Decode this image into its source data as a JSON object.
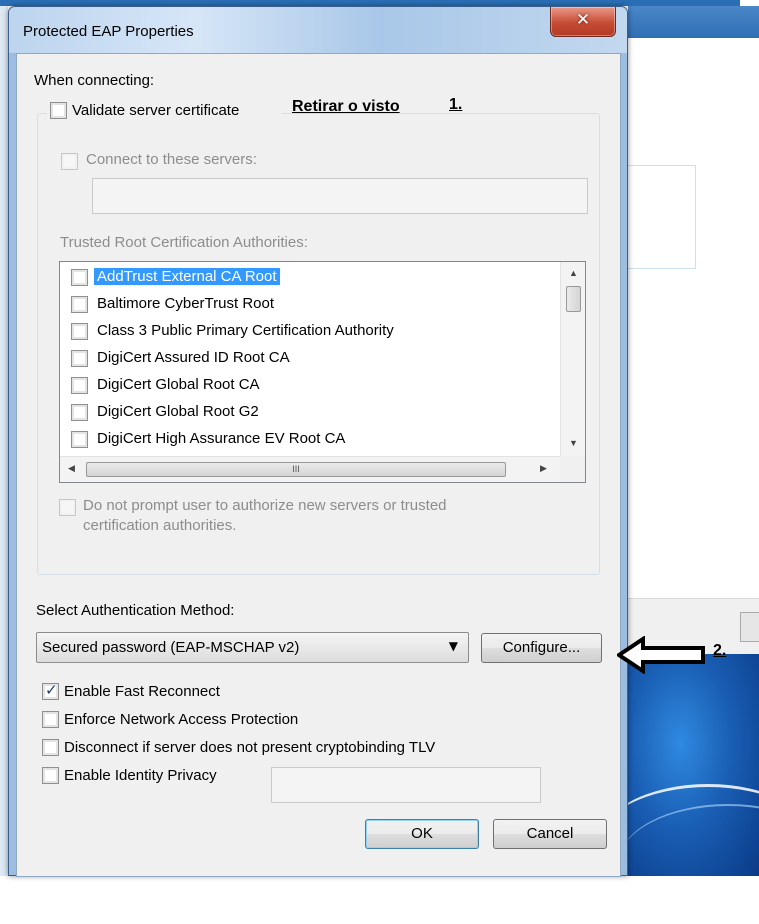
{
  "dialog": {
    "title": "Protected EAP Properties",
    "when_connecting": "When connecting:",
    "validate_server_certificate": {
      "label": "Validate server certificate",
      "checked": false
    },
    "annotation_1_text": "Retirar o visto",
    "annotation_1_number": "1.",
    "connect_to_servers": {
      "label": "Connect to these servers:",
      "checked": false,
      "value": ""
    },
    "trusted_root_label": "Trusted Root Certification Authorities:",
    "trusted_root_list": [
      {
        "label": "AddTrust External CA Root",
        "checked": false,
        "selected": true
      },
      {
        "label": "Baltimore CyberTrust Root",
        "checked": false,
        "selected": false
      },
      {
        "label": "Class 3 Public Primary Certification Authority",
        "checked": false,
        "selected": false
      },
      {
        "label": "DigiCert Assured ID Root CA",
        "checked": false,
        "selected": false
      },
      {
        "label": "DigiCert Global Root CA",
        "checked": false,
        "selected": false
      },
      {
        "label": "DigiCert Global Root G2",
        "checked": false,
        "selected": false
      },
      {
        "label": "DigiCert High Assurance EV Root CA",
        "checked": false,
        "selected": false
      }
    ],
    "do_not_prompt": {
      "line1": "Do not prompt user to authorize new servers or trusted",
      "line2": "certification authorities.",
      "checked": false
    },
    "select_auth_label": "Select Authentication Method:",
    "auth_method_selected": "Secured password (EAP-MSCHAP v2)",
    "configure_button": "Configure...",
    "annotation_2_number": "2.",
    "enable_fast_reconnect": {
      "label": "Enable Fast Reconnect",
      "checked": true
    },
    "enforce_nap": {
      "label": "Enforce Network Access Protection",
      "checked": false
    },
    "disconnect_cryptobinding": {
      "label": "Disconnect if server does not present cryptobinding TLV",
      "checked": false
    },
    "enable_identity_privacy": {
      "label": "Enable Identity Privacy",
      "checked": false,
      "value": ""
    },
    "ok_button": "OK",
    "cancel_button": "Cancel",
    "scrollbar_grip": "III"
  },
  "icons": {
    "close": "close-icon",
    "dropdown": "chevron-down-icon",
    "scroll_up": "scroll-up-icon",
    "scroll_down": "scroll-down-icon",
    "scroll_left": "scroll-left-icon",
    "scroll_right": "scroll-right-icon",
    "annotation_arrow": "left-arrow-icon"
  },
  "colors": {
    "selection": "#3399ff",
    "title_bar": "#bcd4ee",
    "close_button": "#c74b35",
    "dialog_background": "#f0f0f0"
  }
}
